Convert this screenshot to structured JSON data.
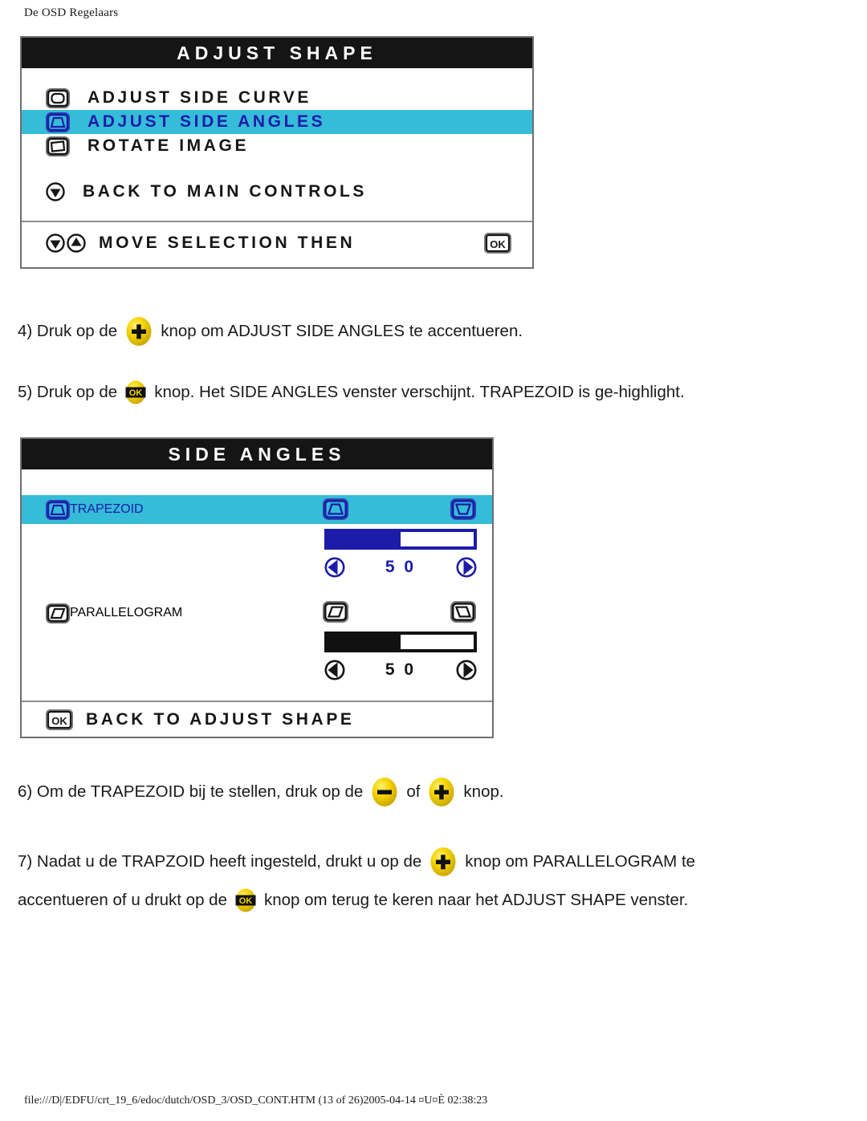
{
  "page": {
    "header": "De OSD Regelaars",
    "footer": "file:///D|/EDFU/crt_19_6/edoc/dutch/OSD_3/OSD_CONT.HTM (13 of 26)2005-04-14 ¤U¤È 02:38:23"
  },
  "colors": {
    "highlight": "#35bcd8",
    "highlight_text": "#1c1ca8",
    "title_bar": "#151515",
    "button_yellow": "#f2d200",
    "panel_border": "#6e6e6e",
    "dark_text": "#161616"
  },
  "osd_adjust_shape": {
    "title": "ADJUST SHAPE",
    "items": [
      {
        "label": "ADJUST SIDE CURVE",
        "icon": "monitor-flat-icon",
        "selected": false
      },
      {
        "label": "ADJUST SIDE ANGLES",
        "icon": "monitor-trapezoid-icon",
        "selected": true
      },
      {
        "label": "ROTATE IMAGE",
        "icon": "monitor-rotate-icon",
        "selected": false
      }
    ],
    "back_item": {
      "label": "BACK TO MAIN CONTROLS",
      "icon": "circle-down-arrow-icon"
    },
    "footer_item": {
      "label": "MOVE SELECTION THEN",
      "icons": [
        "circle-down-arrow-icon",
        "circle-up-arrow-icon"
      ],
      "trailing_icon": "ok-box-icon"
    }
  },
  "osd_side_angles": {
    "title": "SIDE ANGLES",
    "controls": [
      {
        "label": "TRAPEZOID",
        "selected": true,
        "row_icon": "monitor-trapezoid-icon",
        "left_preview_icon": "monitor-trapezoid-narrow-bottom-icon",
        "right_preview_icon": "monitor-trapezoid-narrow-top-icon",
        "value": "5 0",
        "percent": 50,
        "decrease_icon": "triangle-left-icon",
        "increase_icon": "triangle-right-icon"
      },
      {
        "label": "PARALLELOGRAM",
        "selected": false,
        "row_icon": "monitor-parallelogram-icon",
        "left_preview_icon": "monitor-parallelogram-left-icon",
        "right_preview_icon": "monitor-parallelogram-right-icon",
        "value": "5 0",
        "percent": 50,
        "decrease_icon": "triangle-left-icon",
        "increase_icon": "triangle-right-icon"
      }
    ],
    "back_item": {
      "label": "BACK TO ADJUST SHAPE",
      "icon": "ok-box-icon"
    }
  },
  "instructions": [
    {
      "id": "step-4",
      "parts": [
        {
          "type": "text",
          "value": "4) Druk op de"
        },
        {
          "type": "icon",
          "value": "plus-button-icon"
        },
        {
          "type": "text",
          "value": "knop om ADJUST SIDE ANGLES te accentueren."
        }
      ]
    },
    {
      "id": "step-5",
      "parts": [
        {
          "type": "text",
          "value": "5) Druk op de"
        },
        {
          "type": "icon",
          "value": "ok-button-icon"
        },
        {
          "type": "text",
          "value": "knop. Het SIDE ANGLES venster verschijnt. TRAPEZOID is ge-highlight."
        }
      ]
    },
    {
      "id": "step-6",
      "parts": [
        {
          "type": "text",
          "value": "6) Om de TRAPEZOID bij te stellen, druk op de"
        },
        {
          "type": "icon",
          "value": "minus-button-icon"
        },
        {
          "type": "text",
          "value": "of"
        },
        {
          "type": "icon",
          "value": "plus-button-icon"
        },
        {
          "type": "text",
          "value": "knop."
        }
      ]
    },
    {
      "id": "step-7-line1",
      "parts": [
        {
          "type": "text",
          "value": "7) Nadat u de TRAPZOID heeft ingesteld, drukt u op de"
        },
        {
          "type": "icon",
          "value": "plus-button-icon"
        },
        {
          "type": "text",
          "value": "knop om PARALLELOGRAM te"
        }
      ]
    },
    {
      "id": "step-7-line2",
      "parts": [
        {
          "type": "text",
          "value": "accentueren of u drukt op de"
        },
        {
          "type": "icon",
          "value": "ok-button-icon"
        },
        {
          "type": "text",
          "value": "knop om terug te keren naar het ADJUST SHAPE venster."
        }
      ]
    }
  ]
}
